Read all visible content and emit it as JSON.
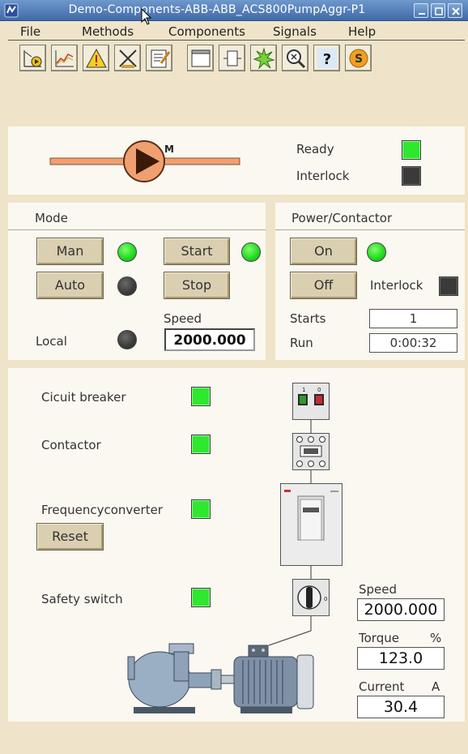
{
  "window": {
    "title": "Demo-Components-ABB-ABB_ACS800PumpAggr-P1"
  },
  "menu": [
    "File",
    "Methods",
    "Components",
    "Signals",
    "Help"
  ],
  "toolbar": [
    "trend-icon",
    "curve-icon",
    "alarm-icon",
    "block-icon",
    "note-icon",
    "window-icon",
    "object-icon",
    "crossref-icon",
    "search-icon",
    "help-icon",
    "s-icon"
  ],
  "pump": {
    "motor_letter": "M",
    "ready_label": "Ready",
    "interlock_label": "Interlock",
    "ready_on": true,
    "interlock_on": false
  },
  "mode": {
    "title": "Mode",
    "man_label": "Man",
    "auto_label": "Auto",
    "start_label": "Start",
    "stop_label": "Stop",
    "speed_label": "Speed",
    "speed_value": "2000.000",
    "local_label": "Local"
  },
  "power": {
    "title": "Power/Contactor",
    "on_label": "On",
    "off_label": "Off",
    "interlock_label": "Interlock",
    "starts_label": "Starts",
    "starts_value": "1",
    "run_label": "Run",
    "run_value": "0:00:32"
  },
  "components": {
    "breaker_label": "Cicuit breaker",
    "contactor_label": "Contactor",
    "converter_label": "Frequencyconverter",
    "reset_label": "Reset",
    "safety_label": "Safety switch"
  },
  "readouts": {
    "speed_label": "Speed",
    "speed_value": "2000.000",
    "torque_label": "Torque",
    "torque_unit": "%",
    "torque_value": "123.0",
    "current_label": "Current",
    "current_unit": "A",
    "current_value": "30.4"
  },
  "colors": {
    "titlebar": "#4f7bb8",
    "background": "#efe4c9",
    "panel": "#fbf8f1",
    "led_on": "#2ee82e",
    "led_off": "#3a3a3a",
    "pump_orange": "#f0a070"
  }
}
